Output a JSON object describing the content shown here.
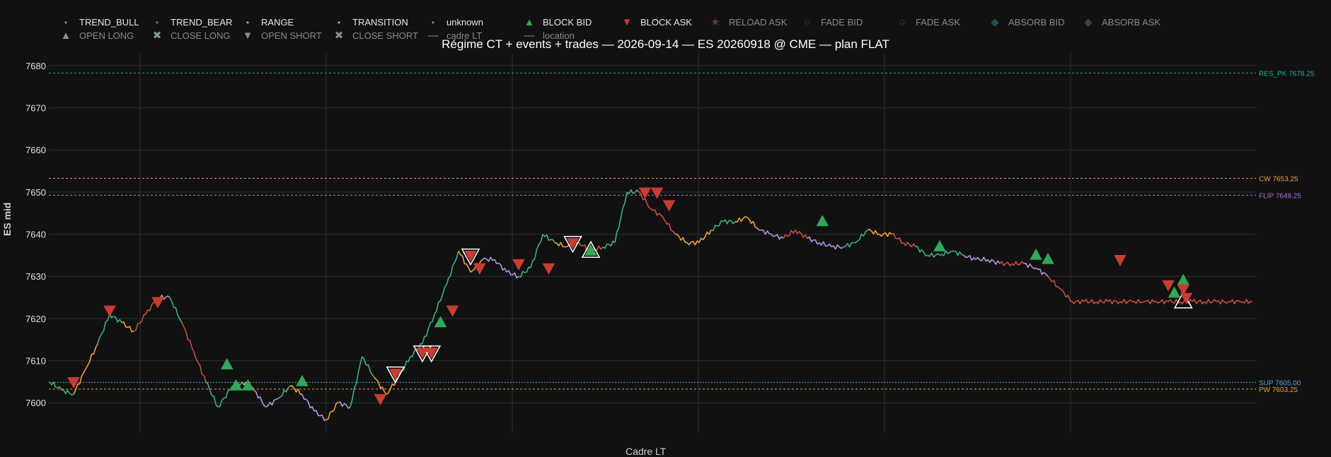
{
  "chart_data": {
    "type": "line",
    "title": "Régime CT + events + trades — 2026-09-14 — ES 20260918 @ CME — plan FLAT",
    "ylabel": "ES mid",
    "xlabel": "Cadre LT",
    "ylim": [
      7593,
      7683
    ],
    "yticks": [
      7600,
      7610,
      7620,
      7630,
      7640,
      7650,
      7660,
      7670,
      7680
    ],
    "grid": true,
    "legend_position": "top-left",
    "legend": [
      {
        "name": "TREND_BULL",
        "symbol": "dot",
        "color": "#3fb37a",
        "visible": true
      },
      {
        "name": "TREND_BEAR",
        "symbol": "dot",
        "color": "#c8503c",
        "visible": true
      },
      {
        "name": "RANGE",
        "symbol": "dot",
        "color": "#b794e0",
        "visible": true
      },
      {
        "name": "TRANSITION",
        "symbol": "dot",
        "color": "#f0a040",
        "visible": true
      },
      {
        "name": "unknown",
        "symbol": "dot",
        "color": "#5fa06f",
        "visible": true
      },
      {
        "name": "BLOCK BID",
        "symbol": "triangle-up",
        "color": "#2ea85a",
        "visible": true
      },
      {
        "name": "BLOCK ASK",
        "symbol": "triangle-down",
        "color": "#c83c32",
        "visible": true
      },
      {
        "name": "RELOAD ASK",
        "symbol": "star",
        "color": "#6b3a32",
        "visible": false
      },
      {
        "name": "FADE BID",
        "symbol": "circle-open",
        "color": "#444444",
        "visible": false
      },
      {
        "name": "FADE ASK",
        "symbol": "circle-open",
        "color": "#444444",
        "visible": false
      },
      {
        "name": "ABSORB BID",
        "symbol": "diamond",
        "color": "#2c4a5e",
        "visible": false
      },
      {
        "name": "ABSORB ASK",
        "symbol": "diamond",
        "color": "#4a3a55",
        "visible": false
      },
      {
        "name": "OPEN LONG",
        "symbol": "triangle-up",
        "color": "#7f96a6",
        "visible": false
      },
      {
        "name": "CLOSE LONG",
        "symbol": "x",
        "color": "#7f96a6",
        "visible": false
      },
      {
        "name": "OPEN SHORT",
        "symbol": "triangle-down",
        "color": "#8a8a8a",
        "visible": false
      },
      {
        "name": "CLOSE SHORT",
        "symbol": "x",
        "color": "#8a8a8a",
        "visible": false
      },
      {
        "name": "cadre LT",
        "symbol": "line",
        "color": "#8a8a8a",
        "visible": false
      },
      {
        "name": "location",
        "symbol": "line",
        "color": "#8a8a8a",
        "visible": false
      }
    ],
    "levels": [
      {
        "label": "RES_PK 7678.25",
        "value": 7678.25,
        "color": "#26a69a"
      },
      {
        "label": "CW 7653.25",
        "value": 7653.25,
        "color": "#f0a040"
      },
      {
        "label": "FLIP 7649.25",
        "value": 7649.25,
        "color": "#b070d8"
      },
      {
        "label": "PW 7603.25",
        "value": 7603.25,
        "color": "#f0a040"
      }
    ],
    "overlapped_level_label": {
      "text": "SUP 7605.00",
      "value": 7605.0,
      "color": "#4aa8d8"
    },
    "series": [
      {
        "name": "ES mid",
        "x": [
          0,
          4,
          8,
          12,
          16,
          20,
          24,
          28,
          32,
          36,
          40,
          44,
          48,
          52,
          56,
          60,
          64,
          68,
          72,
          76,
          80,
          84,
          88,
          92,
          96,
          100,
          104,
          108,
          112,
          116,
          120,
          124,
          128,
          132,
          136,
          140,
          144,
          148,
          152,
          156,
          160,
          164,
          168,
          172,
          176,
          180,
          184,
          188,
          192,
          196,
          200,
          204,
          208,
          212,
          216,
          220,
          224,
          228,
          232,
          236,
          240,
          244,
          248,
          252,
          256,
          260,
          264,
          268,
          272,
          276,
          280,
          284,
          288,
          292,
          296,
          300,
          304,
          308,
          312,
          316,
          320,
          324,
          328,
          332,
          336,
          340,
          344,
          348,
          352,
          356,
          360,
          364,
          368,
          372,
          376,
          380,
          384,
          388,
          392,
          396,
          400
        ],
        "y": [
          7605,
          7603,
          7602,
          7608,
          7614,
          7621,
          7619,
          7617,
          7621,
          7625,
          7625,
          7619,
          7612,
          7605,
          7599,
          7603,
          7605,
          7603,
          7599,
          7601,
          7604,
          7602,
          7598,
          7596,
          7600,
          7599,
          7611,
          7606,
          7602,
          7606,
          7611,
          7614,
          7621,
          7628,
          7636,
          7631,
          7634,
          7634,
          7631,
          7630,
          7632,
          7640,
          7638,
          7637,
          7638,
          7636,
          7637,
          7638,
          7650,
          7650,
          7646,
          7644,
          7640,
          7638,
          7638,
          7641,
          7643,
          7643,
          7644,
          7641,
          7640,
          7639,
          7641,
          7639,
          7638,
          7637,
          7637,
          7638,
          7641,
          7640,
          7640,
          7638,
          7637,
          7635,
          7635,
          7636,
          7635,
          7634,
          7634,
          7633,
          7633,
          7633,
          7632,
          7630,
          7627,
          7624,
          7624,
          7624,
          7624,
          7624,
          7624,
          7624,
          7624,
          7624,
          7624,
          7624,
          7624,
          7624,
          7624,
          7624,
          7624
        ],
        "regime": [
          "G",
          "G",
          "O",
          "O",
          "G",
          "G",
          "O",
          "B",
          "B",
          "P",
          "G",
          "B",
          "B",
          "G",
          "G",
          "G",
          "O",
          "P",
          "P",
          "G",
          "O",
          "P",
          "P",
          "O",
          "P",
          "G",
          "G",
          "O",
          "O",
          "G",
          "G",
          "G",
          "G",
          "G",
          "O",
          "O",
          "P",
          "P",
          "P",
          "G",
          "G",
          "G",
          "O",
          "O",
          "B",
          "B",
          "G",
          "G",
          "G",
          "B",
          "B",
          "B",
          "O",
          "O",
          "O",
          "G",
          "G",
          "O",
          "O",
          "P",
          "P",
          "B",
          "B",
          "P",
          "P",
          "P",
          "G",
          "G",
          "O",
          "O",
          "B",
          "B",
          "G",
          "G",
          "G",
          "G",
          "P",
          "P",
          "P",
          "B",
          "B",
          "P",
          "P",
          "B",
          "B",
          "B",
          "B",
          "B",
          "B",
          "B",
          "B",
          "B",
          "B",
          "B",
          "B",
          "B",
          "B",
          "B",
          "B",
          "B",
          "B"
        ]
      }
    ],
    "x_extent": 400,
    "events": [
      {
        "type": "BLOCK ASK",
        "x": 8,
        "y": 7605
      },
      {
        "type": "BLOCK ASK",
        "x": 20,
        "y": 7622
      },
      {
        "type": "BLOCK ASK",
        "x": 36,
        "y": 7624
      },
      {
        "type": "BLOCK BID",
        "x": 59,
        "y": 7609
      },
      {
        "type": "BLOCK BID",
        "x": 62,
        "y": 7604
      },
      {
        "type": "BLOCK BID",
        "x": 66,
        "y": 7604
      },
      {
        "type": "BLOCK BID",
        "x": 84,
        "y": 7605
      },
      {
        "type": "BLOCK ASK",
        "x": 110,
        "y": 7601
      },
      {
        "type": "BLOCK ASK",
        "x": 115,
        "y": 7607
      },
      {
        "type": "BLOCK ASK",
        "x": 124,
        "y": 7612
      },
      {
        "type": "BLOCK ASK",
        "x": 127,
        "y": 7612
      },
      {
        "type": "BLOCK BID",
        "x": 130,
        "y": 7619
      },
      {
        "type": "BLOCK ASK",
        "x": 134,
        "y": 7622
      },
      {
        "type": "BLOCK ASK",
        "x": 140,
        "y": 7635
      },
      {
        "type": "BLOCK ASK",
        "x": 143,
        "y": 7632
      },
      {
        "type": "BLOCK ASK",
        "x": 156,
        "y": 7633
      },
      {
        "type": "BLOCK ASK",
        "x": 166,
        "y": 7632
      },
      {
        "type": "BLOCK ASK",
        "x": 174,
        "y": 7638
      },
      {
        "type": "BLOCK BID",
        "x": 180,
        "y": 7636
      },
      {
        "type": "BLOCK ASK",
        "x": 198,
        "y": 7650
      },
      {
        "type": "BLOCK ASK",
        "x": 202,
        "y": 7650
      },
      {
        "type": "BLOCK ASK",
        "x": 206,
        "y": 7647
      },
      {
        "type": "BLOCK BID",
        "x": 257,
        "y": 7643
      },
      {
        "type": "BLOCK BID",
        "x": 296,
        "y": 7637
      },
      {
        "type": "BLOCK BID",
        "x": 328,
        "y": 7635
      },
      {
        "type": "BLOCK BID",
        "x": 332,
        "y": 7634
      },
      {
        "type": "BLOCK ASK",
        "x": 356,
        "y": 7634
      },
      {
        "type": "BLOCK ASK",
        "x": 372,
        "y": 7628
      },
      {
        "type": "BLOCK BID",
        "x": 374,
        "y": 7626
      },
      {
        "type": "BLOCK BID",
        "x": 377,
        "y": 7629
      },
      {
        "type": "BLOCK ASK",
        "x": 377,
        "y": 7627
      },
      {
        "type": "BLOCK ASK",
        "x": 378,
        "y": 7625
      }
    ],
    "trade_markers": [
      {
        "type": "OPEN SHORT",
        "x": 140,
        "y": 7635
      },
      {
        "type": "OPEN SHORT",
        "x": 124,
        "y": 7612
      },
      {
        "type": "OPEN SHORT",
        "x": 127,
        "y": 7612
      },
      {
        "type": "OPEN SHORT",
        "x": 115,
        "y": 7607
      },
      {
        "type": "OPEN SHORT",
        "x": 174,
        "y": 7638
      },
      {
        "type": "OPEN LONG",
        "x": 180,
        "y": 7636
      },
      {
        "type": "OPEN LONG",
        "x": 377,
        "y": 7624
      }
    ]
  }
}
